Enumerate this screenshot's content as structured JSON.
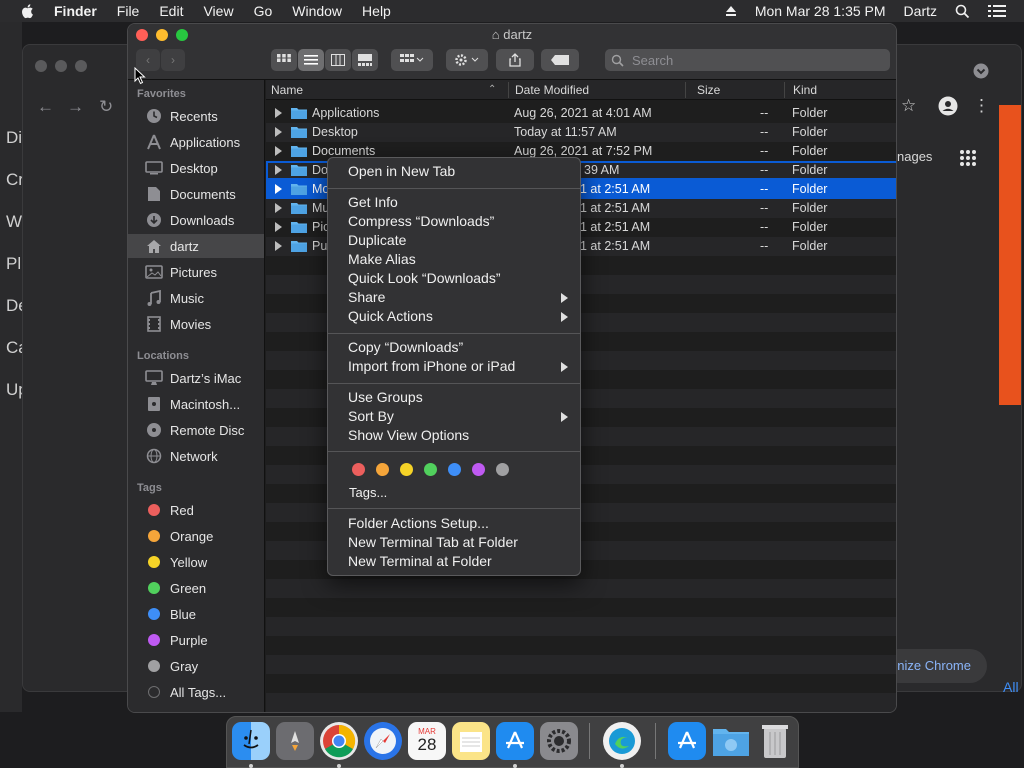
{
  "menubar": {
    "app": "Finder",
    "items": [
      "File",
      "Edit",
      "View",
      "Go",
      "Window",
      "Help"
    ],
    "clock": "Mon Mar 28  1:35 PM",
    "user": "Dartz"
  },
  "chrome_bg": {
    "left_letters": [
      "Di",
      "Cr",
      "W",
      "Pl",
      "De",
      "Ca",
      "Up"
    ],
    "images_text": "nages",
    "customize": "nize Chrome",
    "all_text": "All"
  },
  "window": {
    "title": "dartz",
    "search_placeholder": "Search"
  },
  "sidebar": {
    "favorites_header": "Favorites",
    "favorites": [
      {
        "label": "Recents",
        "icon": "clock-icon"
      },
      {
        "label": "Applications",
        "icon": "applications-icon"
      },
      {
        "label": "Desktop",
        "icon": "desktop-icon"
      },
      {
        "label": "Documents",
        "icon": "document-icon"
      },
      {
        "label": "Downloads",
        "icon": "download-icon"
      },
      {
        "label": "dartz",
        "icon": "home-icon"
      },
      {
        "label": "Pictures",
        "icon": "pictures-icon"
      },
      {
        "label": "Music",
        "icon": "music-icon"
      },
      {
        "label": "Movies",
        "icon": "movies-icon"
      }
    ],
    "locations_header": "Locations",
    "locations": [
      {
        "label": "Dartz’s iMac",
        "icon": "imac-icon"
      },
      {
        "label": "Macintosh...",
        "icon": "disk-icon"
      },
      {
        "label": "Remote Disc",
        "icon": "disc-icon"
      },
      {
        "label": "Network",
        "icon": "network-icon"
      }
    ],
    "tags_header": "Tags",
    "tags": [
      {
        "label": "Red",
        "color": "#ec5f5d"
      },
      {
        "label": "Orange",
        "color": "#f5a53a"
      },
      {
        "label": "Yellow",
        "color": "#f5d327"
      },
      {
        "label": "Green",
        "color": "#51d05d"
      },
      {
        "label": "Blue",
        "color": "#3e8ef7"
      },
      {
        "label": "Purple",
        "color": "#bf5af2"
      },
      {
        "label": "Gray",
        "color": "#a0a0a2"
      },
      {
        "label": "All Tags...",
        "color": "#6e6e70"
      }
    ]
  },
  "columns": {
    "name": "Name",
    "date": "Date Modified",
    "size": "Size",
    "kind": "Kind"
  },
  "rows": [
    {
      "name": "Applications",
      "date": "Aug 26, 2021 at 4:01 AM",
      "size": "--",
      "kind": "Folder"
    },
    {
      "name": "Desktop",
      "date": "Today at 11:57 AM",
      "size": "--",
      "kind": "Folder"
    },
    {
      "name": "Documents",
      "date": "Aug 26, 2021 at 7:52 PM",
      "size": "--",
      "kind": "Folder"
    },
    {
      "name": "Do",
      "date": "39 AM",
      "size": "--",
      "kind": "Folder"
    },
    {
      "name": "Mo",
      "date": "1 at 2:51 AM",
      "size": "--",
      "kind": "Folder"
    },
    {
      "name": "Mu",
      "date": "1 at 2:51 AM",
      "size": "--",
      "kind": "Folder"
    },
    {
      "name": "Pic",
      "date": "1 at 2:51 AM",
      "size": "--",
      "kind": "Folder"
    },
    {
      "name": "Pu",
      "date": "1 at 2:51 AM",
      "size": "--",
      "kind": "Folder"
    }
  ],
  "context_menu": {
    "open_new_tab": "Open in New Tab",
    "get_info": "Get Info",
    "compress": "Compress “Downloads”",
    "duplicate": "Duplicate",
    "make_alias": "Make Alias",
    "quick_look": "Quick Look “Downloads”",
    "share": "Share",
    "quick_actions": "Quick Actions",
    "copy": "Copy “Downloads”",
    "import": "Import from iPhone or iPad",
    "use_groups": "Use Groups",
    "sort_by": "Sort By",
    "show_view_options": "Show View Options",
    "tag_colors": [
      "#ec5f5d",
      "#f5a53a",
      "#f5d327",
      "#51d05d",
      "#3e8ef7",
      "#bf5af2",
      "#a0a0a2"
    ],
    "tags": "Tags...",
    "folder_actions": "Folder Actions Setup...",
    "new_terminal_tab": "New Terminal Tab at Folder",
    "new_terminal": "New Terminal at Folder"
  },
  "dock": {
    "calendar_month": "MAR",
    "calendar_day": "28"
  }
}
